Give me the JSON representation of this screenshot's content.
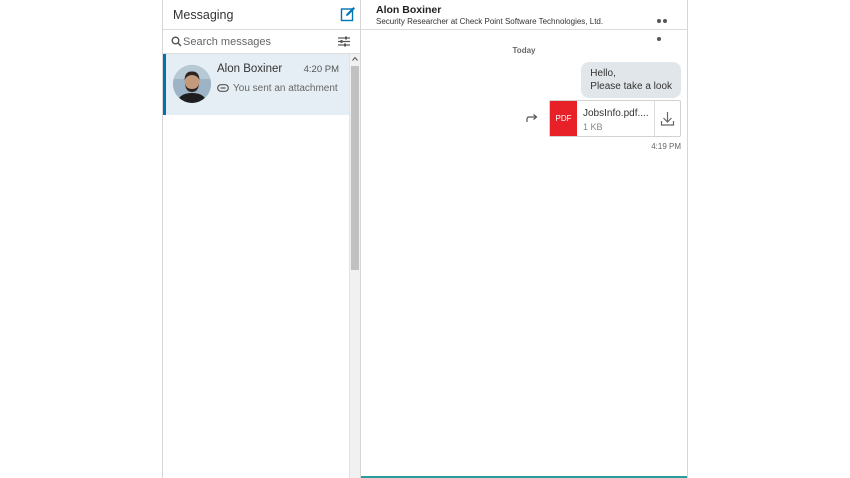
{
  "left": {
    "title": "Messaging",
    "search_placeholder": "Search messages",
    "conversations": [
      {
        "name": "Alon Boxiner",
        "time": "4:20 PM",
        "preview": "You sent an attachment"
      }
    ]
  },
  "thread": {
    "contact_name": "Alon Boxiner",
    "contact_headline": "Security Researcher at Check Point Software Technologies, Ltd.",
    "day_label": "Today",
    "message_line1": "Hello,",
    "message_line2": "Please take a look",
    "attachment": {
      "badge": "PDF",
      "name": "JobsInfo.pdf....",
      "size": "1 KB"
    },
    "message_time": "4:19 PM"
  },
  "colors": {
    "accent": "#0073b1",
    "selected_bg": "#e5eef4",
    "bubble_bg": "#e1e6ea",
    "pdf_red": "#e82027"
  }
}
